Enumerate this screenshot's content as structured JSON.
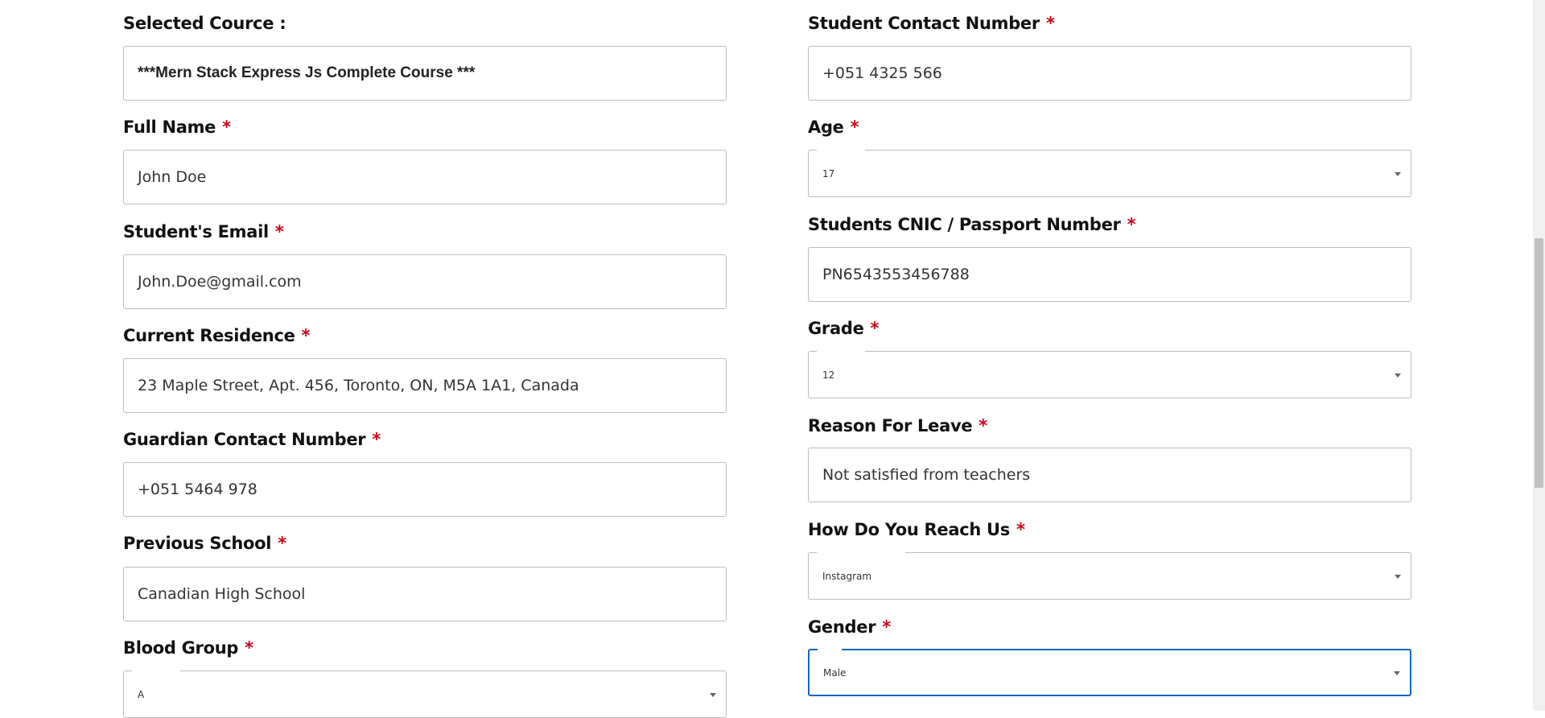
{
  "required_mark": "*",
  "left": {
    "selected_course": {
      "label": "Selected Cource :",
      "value": "***Mern Stack Express Js Complete Course  ***"
    },
    "full_name": {
      "label": "Full Name",
      "value": "John Doe"
    },
    "email": {
      "label": "Student's Email",
      "value": "John.Doe@gmail.com"
    },
    "residence": {
      "label": "Current Residence",
      "value": "23 Maple Street, Apt. 456, Toronto, ON, M5A 1A1, Canada"
    },
    "guardian_contact": {
      "label": "Guardian Contact Number",
      "value": "+051 5464 978"
    },
    "previous_school": {
      "label": "Previous School",
      "value": "Canadian High School"
    },
    "blood_group": {
      "label": "Blood Group",
      "value": "A"
    }
  },
  "right": {
    "student_contact": {
      "label": "Student Contact Number",
      "value": "+051 4325 566"
    },
    "age": {
      "label": "Age",
      "value": "17"
    },
    "cnic": {
      "label": "Students CNIC / Passport Number",
      "value": "PN6543553456788"
    },
    "grade": {
      "label": "Grade",
      "value": "12"
    },
    "reason": {
      "label": "Reason For Leave",
      "value": "Not satisfied from teachers"
    },
    "reach": {
      "label": "How Do You Reach Us",
      "value": "Instagram"
    },
    "gender": {
      "label": "Gender",
      "value": "Male"
    }
  },
  "icons": {
    "select_caret": "caret-down-icon"
  }
}
